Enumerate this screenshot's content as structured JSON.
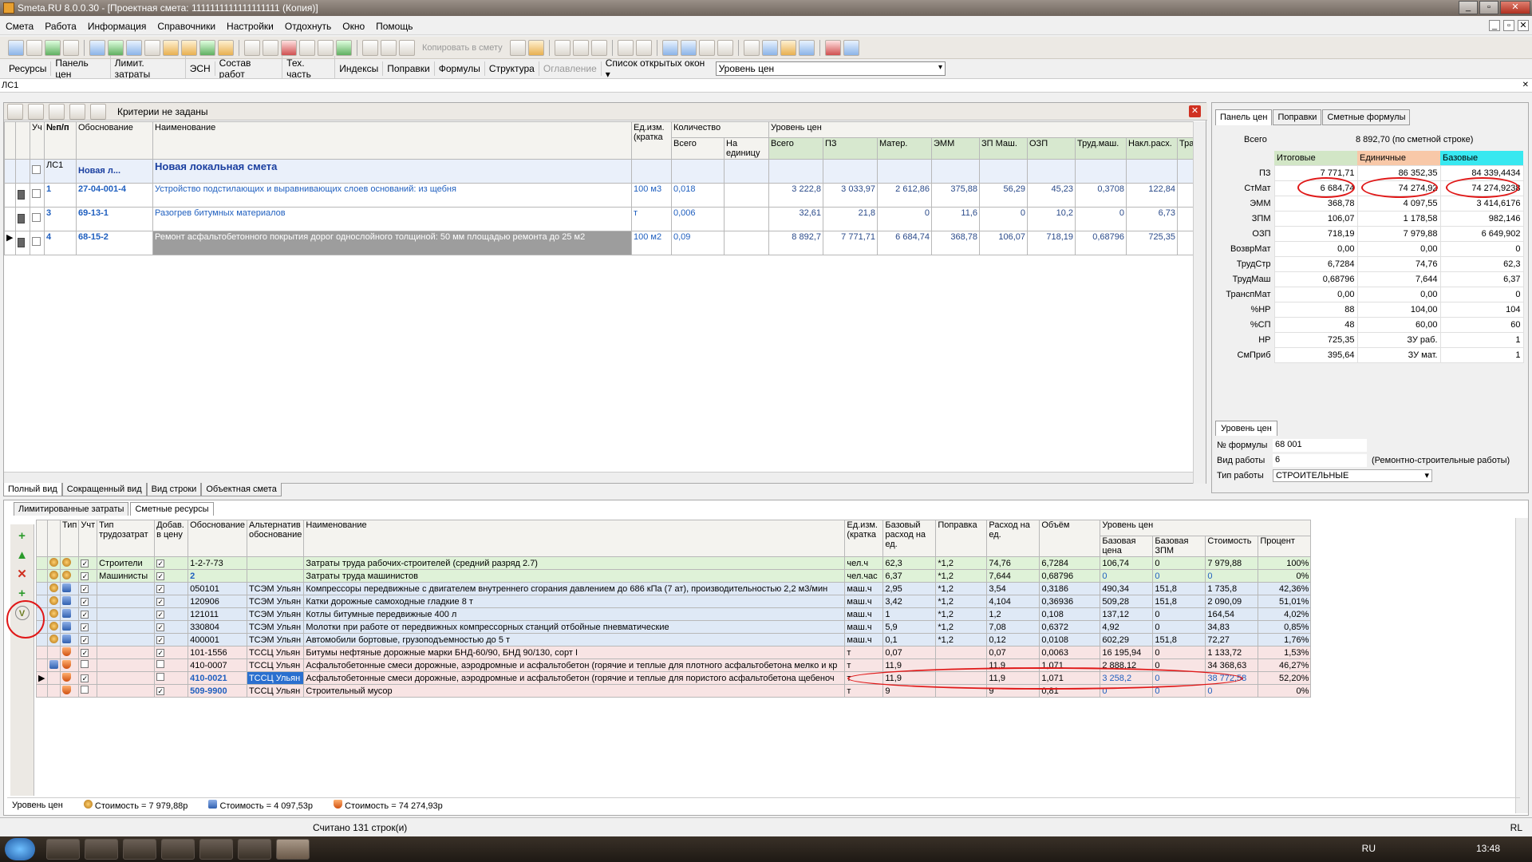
{
  "window": {
    "title": "Smeta.RU  8.0.0.30  - [Проектная смета: 1111111111111111111 (Копия)]",
    "btn_min": "_",
    "btn_max": "▫",
    "btn_close": "✕"
  },
  "menu": [
    "Смета",
    "Работа",
    "Информация",
    "Справочники",
    "Настройки",
    "Отдохнуть",
    "Окно",
    "Помощь"
  ],
  "toolbar": {
    "copy_label": "Копировать в смету"
  },
  "toolbar2": {
    "tabs": [
      "Ресурсы",
      "Панель цен",
      "Лимит. затраты",
      "ЭСН",
      "Состав работ",
      "Тех. часть",
      "Индексы",
      "Поправки",
      "Формулы",
      "Структура"
    ],
    "disabled": "Оглавление",
    "open_windows": "Список открытых окон",
    "price_level": "Уровень цен"
  },
  "doc": {
    "name": "ЛС1"
  },
  "upper": {
    "criteria": "Критерии не заданы",
    "headers": {
      "ut": "Уч",
      "np": "№п/п",
      "obos": "Обоснование",
      "naim": "Наименование",
      "ed": "Ед.изм. (кратка",
      "kol": "Количество",
      "vsego": "Всего",
      "na_ed": "На единицу",
      "uroven": "Уровень цен",
      "cols": [
        "Всего",
        "ПЗ",
        "Матер.",
        "ЭММ",
        "ЗП Маш.",
        "ОЗП",
        "Труд.маш.",
        "Накл.расх.",
        "Тра"
      ]
    },
    "group": {
      "code": "ЛС1",
      "short": "Новая л...",
      "name": "Новая локальная смета"
    },
    "rows": [
      {
        "n": "1",
        "code": "27-04-001-4",
        "name": "Устройство подстилающих и выравнивающих слоев оснований: из щебня",
        "ed": "100 м3",
        "q": "0,018",
        "v": [
          "3 222,8",
          "3 033,97",
          "2 612,86",
          "375,88",
          "56,29",
          "45,23",
          "0,3708",
          "122,84"
        ]
      },
      {
        "n": "3",
        "code": "69-13-1",
        "name": "Разогрев битумных материалов",
        "ed": "т",
        "q": "0,006",
        "v": [
          "32,61",
          "21,8",
          "0",
          "11,6",
          "0",
          "10,2",
          "0",
          "6,73"
        ]
      },
      {
        "n": "4",
        "code": "68-15-2",
        "name": "Ремонт асфальтобетонного покрытия дорог однослойного толщиной: 50 мм площадью ремонта до 25 м2",
        "ed": "100 м2",
        "q": "0,09",
        "v": [
          "8 892,7",
          "7 771,71",
          "6 684,74",
          "368,78",
          "106,07",
          "718,19",
          "0,68796",
          "725,35"
        ]
      }
    ]
  },
  "view_tabs": [
    "Полный вид",
    "Сокращенный вид",
    "Вид строки",
    "Объектная смета"
  ],
  "rpanel": {
    "tabs": [
      "Панель цен",
      "Поправки",
      "Сметные формулы"
    ],
    "total_label": "Всего",
    "total_value": "8 892,70  (по сметной строке)",
    "col_heads": [
      "Итоговые",
      "Единичные",
      "Базовые"
    ],
    "rows": [
      {
        "l": "ПЗ",
        "a": "7 771,71",
        "b": "86 352,35",
        "c": "84 339,4434"
      },
      {
        "l": "СтМат",
        "a": "6 684,74",
        "b": "74 274,92",
        "c": "74 274,9238"
      },
      {
        "l": "ЭММ",
        "a": "368,78",
        "b": "4 097,55",
        "c": "3 414,6176"
      },
      {
        "l": "ЗПМ",
        "a": "106,07",
        "b": "1 178,58",
        "c": "982,146"
      },
      {
        "l": "ОЗП",
        "a": "718,19",
        "b": "7 979,88",
        "c": "6 649,902"
      },
      {
        "l": "ВозврМат",
        "a": "0,00",
        "b": "0,00",
        "c": "0"
      },
      {
        "l": "ТрудСтр",
        "a": "6,7284",
        "b": "74,76",
        "c": "62,3"
      },
      {
        "l": "ТрудМаш",
        "a": "0,68796",
        "b": "7,644",
        "c": "6,37"
      },
      {
        "l": "ТранспМат",
        "a": "0,00",
        "b": "0,00",
        "c": "0"
      },
      {
        "l": "%НР",
        "a": "88",
        "b": "104,00",
        "c": "104"
      },
      {
        "l": "%СП",
        "a": "48",
        "b": "60,00",
        "c": "60"
      },
      {
        "l": "НР",
        "a": "725,35",
        "b": "ЗУ раб.",
        "c": "1"
      },
      {
        "l": "СмПриб",
        "a": "395,64",
        "b": "ЗУ мат.",
        "c": "1"
      }
    ],
    "bottom_tab": "Уровень цен",
    "formula_label": "№ формулы",
    "formula_value": "68 001",
    "work_label": "Вид работы",
    "work_value": "6",
    "work_extra": "(Ремонтно-строительные работы)",
    "type_label": "Тип работы",
    "type_value": "СТРОИТЕЛЬНЫЕ"
  },
  "lower": {
    "tabs": [
      "Лимитированные затраты",
      "Сметные ресурсы"
    ],
    "headers": {
      "tip": "Тип",
      "ut": "Учт",
      "tipt": "Тип трудозатрат",
      "dob": "Добав. в цену",
      "obos": "Обоснование",
      "alt": "Альтернатив обоснование",
      "naim": "Наименование",
      "ed": "Ед.изм. (кратка",
      "baz": "Базовый расход на ед.",
      "popr": "Поправка",
      "rash": "Расход на ед.",
      "obj": "Объём",
      "uroven": "Уровень цен",
      "bc": "Базовая цена",
      "bz": "Базовая ЗПМ",
      "st": "Стоимость",
      "pr": "Процент"
    },
    "rows": [
      {
        "cls": "green",
        "ico": "lab",
        "tt": "Строители",
        "code": "1-2-7-73",
        "alt": "",
        "name": "Затраты труда рабочих-строителей (средний разряд 2.7)",
        "ed": "чел.ч",
        "baz": "62,3",
        "p": "*1,2",
        "r": "74,76",
        "o": "6,7284",
        "bc": "106,74",
        "bz": "0",
        "s": "7 979,88",
        "pc": "100%",
        "chk": true
      },
      {
        "cls": "green",
        "ico": "lab",
        "tt": "Машинисты",
        "code": "2",
        "alt": "",
        "name": "Затраты труда машинистов",
        "ed": "чел.час",
        "baz": "6,37",
        "p": "*1,2",
        "r": "7,644",
        "o": "0,68796",
        "bc": "0",
        "bz": "0",
        "s": "0",
        "pc": "0%",
        "chk": true
      },
      {
        "cls": "blue",
        "ico": "mach",
        "tt": "",
        "code": "050101",
        "alt": "ТСЭМ Ульян",
        "name": "Компрессоры передвижные с двигателем внутреннего сгорания давлением до 686 кПа (7 ат), производительностью 2,2 м3/мин",
        "ed": "маш.ч",
        "baz": "2,95",
        "p": "*1,2",
        "r": "3,54",
        "o": "0,3186",
        "bc": "490,34",
        "bz": "151,8",
        "s": "1 735,8",
        "pc": "42,36%",
        "chk": true
      },
      {
        "cls": "blue",
        "ico": "mach",
        "tt": "",
        "code": "120906",
        "alt": "ТСЭМ Ульян",
        "name": "Катки дорожные самоходные гладкие 8 т",
        "ed": "маш.ч",
        "baz": "3,42",
        "p": "*1,2",
        "r": "4,104",
        "o": "0,36936",
        "bc": "509,28",
        "bz": "151,8",
        "s": "2 090,09",
        "pc": "51,01%",
        "chk": true
      },
      {
        "cls": "blue",
        "ico": "mach",
        "tt": "",
        "code": "121011",
        "alt": "ТСЭМ Ульян",
        "name": "Котлы битумные передвижные 400 л",
        "ed": "маш.ч",
        "baz": "1",
        "p": "*1,2",
        "r": "1,2",
        "o": "0,108",
        "bc": "137,12",
        "bz": "0",
        "s": "164,54",
        "pc": "4,02%",
        "chk": true
      },
      {
        "cls": "blue",
        "ico": "mach",
        "tt": "",
        "code": "330804",
        "alt": "ТСЭМ Ульян",
        "name": "Молотки при работе от передвижных компрессорных станций отбойные пневматические",
        "ed": "маш.ч",
        "baz": "5,9",
        "p": "*1,2",
        "r": "7,08",
        "o": "0,6372",
        "bc": "4,92",
        "bz": "0",
        "s": "34,83",
        "pc": "0,85%",
        "chk": true
      },
      {
        "cls": "blue",
        "ico": "mach",
        "tt": "",
        "code": "400001",
        "alt": "ТСЭМ Ульян",
        "name": "Автомобили бортовые, грузоподъемностью до 5 т",
        "ed": "маш.ч",
        "baz": "0,1",
        "p": "*1,2",
        "r": "0,12",
        "o": "0,0108",
        "bc": "602,29",
        "bz": "151,8",
        "s": "72,27",
        "pc": "1,76%",
        "chk": true
      },
      {
        "cls": "pink",
        "ico": "mat",
        "tt": "",
        "code": "101-1556",
        "alt": "ТССЦ Ульян",
        "name": "Битумы нефтяные дорожные марки БНД-60/90, БНД 90/130, сорт I",
        "ed": "т",
        "baz": "0,07",
        "p": "",
        "r": "0,07",
        "o": "0,0063",
        "bc": "16 195,94",
        "bz": "0",
        "s": "1 133,72",
        "pc": "1,53%",
        "chk": true
      },
      {
        "cls": "pink",
        "ico": "mat",
        "tt": "",
        "code": "410-0007",
        "alt": "ТССЦ Ульян",
        "name": "Асфальтобетонные смеси дорожные, аэродромные и асфальтобетон (горячие и теплые для плотного асфальтобетона мелко и кр",
        "ed": "т",
        "baz": "11,9",
        "p": "",
        "r": "11,9",
        "o": "1,071",
        "bc": "2 888,12",
        "bz": "0",
        "s": "34 368,63",
        "pc": "46,27%",
        "chk": false
      },
      {
        "cls": "pink sel",
        "ico": "mat",
        "tt": "",
        "code": "410-0021",
        "alt": "ТССЦ Ульян",
        "name": "Асфальтобетонные смеси дорожные, аэродромные и асфальтобетон (горячие и теплые для пористого асфальтобетона щебеноч",
        "ed": "т",
        "baz": "11,9",
        "p": "",
        "r": "11,9",
        "o": "1,071",
        "bc": "3 258,2",
        "bz": "0",
        "s": "38 772,58",
        "pc": "52,20%",
        "chk": true
      },
      {
        "cls": "pink",
        "ico": "mat",
        "tt": "",
        "code": "509-9900",
        "alt": "ТССЦ Ульян",
        "name": "Строительный мусор",
        "ed": "т",
        "baz": "9",
        "p": "",
        "r": "9",
        "o": "0,81",
        "bc": "0",
        "bz": "0",
        "s": "0",
        "pc": "0%",
        "chk": true
      }
    ],
    "status": [
      "Уровень цен",
      "Стоимость = 7 979,88р",
      "Стоимость = 4 097,53р",
      "Стоимость = 74 274,93р"
    ]
  },
  "statusbar": {
    "text": "Считано 131 строк(и)",
    "lang": "RL"
  },
  "taskbar": {
    "lang": "RU",
    "clock": "13:48"
  }
}
